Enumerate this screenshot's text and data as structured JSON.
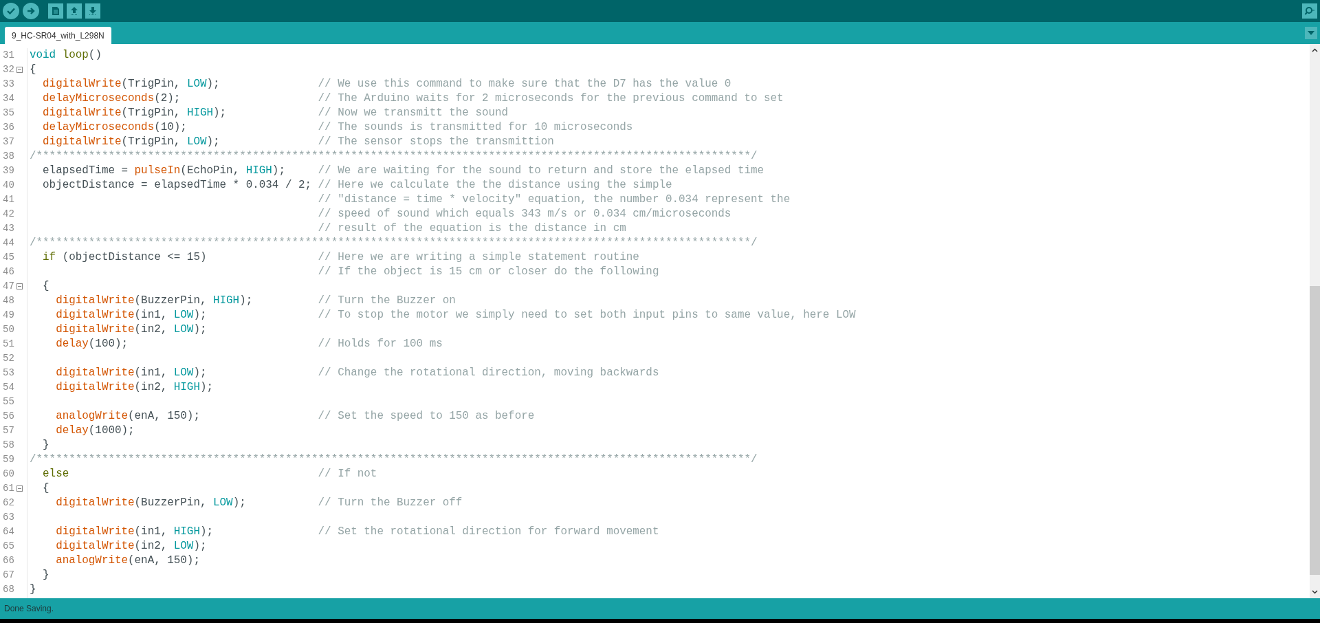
{
  "tab": {
    "label": "9_HC-SR04_with_L298N",
    "selected": true
  },
  "lines": [
    {
      "number": "31",
      "foldable": false,
      "code": [
        {
          "kind": "type",
          "text": "void"
        },
        {
          "kind": "keyword",
          "text": " loop"
        },
        {
          "kind": "plain",
          "text": "()"
        }
      ]
    },
    {
      "number": "32",
      "foldable": true,
      "code": [
        {
          "kind": "plain",
          "text": "{"
        }
      ]
    },
    {
      "number": "33",
      "foldable": false,
      "code": [
        {
          "kind": "function",
          "text": "  digitalWrite"
        },
        {
          "kind": "plain",
          "text": "(TrigPin, "
        },
        {
          "kind": "constant",
          "text": "LOW"
        },
        {
          "kind": "plain",
          "text": ");"
        }
      ],
      "comment": "// We use this command to make sure that the D7 has the value 0"
    },
    {
      "number": "34",
      "foldable": false,
      "code": [
        {
          "kind": "function",
          "text": "  delayMicroseconds"
        },
        {
          "kind": "plain",
          "text": "(2);"
        }
      ],
      "comment": "// The Arduino waits for 2 microseconds for the previous command to set"
    },
    {
      "number": "35",
      "foldable": false,
      "code": [
        {
          "kind": "function",
          "text": "  digitalWrite"
        },
        {
          "kind": "plain",
          "text": "(TrigPin, "
        },
        {
          "kind": "constant",
          "text": "HIGH"
        },
        {
          "kind": "plain",
          "text": ");"
        }
      ],
      "comment": "// Now we transmitt the sound"
    },
    {
      "number": "36",
      "foldable": false,
      "code": [
        {
          "kind": "function",
          "text": "  delayMicroseconds"
        },
        {
          "kind": "plain",
          "text": "(10);"
        }
      ],
      "comment": "// The sounds is transmitted for 10 microseconds"
    },
    {
      "number": "37",
      "foldable": false,
      "code": [
        {
          "kind": "function",
          "text": "  digitalWrite"
        },
        {
          "kind": "plain",
          "text": "(TrigPin, "
        },
        {
          "kind": "constant",
          "text": "LOW"
        },
        {
          "kind": "plain",
          "text": ");"
        }
      ],
      "comment": "// The sensor stops the transmittion"
    },
    {
      "number": "38",
      "foldable": false,
      "code": [
        {
          "kind": "comment",
          "text": "/*************************************************************************************************************/"
        }
      ]
    },
    {
      "number": "39",
      "foldable": false,
      "code": [
        {
          "kind": "plain",
          "text": "  elapsedTime = "
        },
        {
          "kind": "function",
          "text": "pulseIn"
        },
        {
          "kind": "plain",
          "text": "(EchoPin, "
        },
        {
          "kind": "constant",
          "text": "HIGH"
        },
        {
          "kind": "plain",
          "text": ");"
        }
      ],
      "comment": "// We are waiting for the sound to return and store the elapsed time"
    },
    {
      "number": "40",
      "foldable": false,
      "code": [
        {
          "kind": "plain",
          "text": "  objectDistance = elapsedTime * 0.034 / 2;"
        }
      ],
      "comment": "// Here we calculate the the distance using the simple"
    },
    {
      "number": "41",
      "foldable": false,
      "comment": "// \"distance = time * velocity\" equation, the number 0.034 represent the"
    },
    {
      "number": "42",
      "foldable": false,
      "comment": "// speed of sound which equals 343 m/s or 0.034 cm/microseconds"
    },
    {
      "number": "43",
      "foldable": false,
      "comment": "// result of the equation is the distance in cm"
    },
    {
      "number": "44",
      "foldable": false,
      "code": [
        {
          "kind": "comment",
          "text": "/*************************************************************************************************************/"
        }
      ]
    },
    {
      "number": "45",
      "foldable": false,
      "code": [
        {
          "kind": "keyword",
          "text": "  if"
        },
        {
          "kind": "plain",
          "text": " (objectDistance <= 15)"
        }
      ],
      "comment": "// Here we are writing a simple statement routine"
    },
    {
      "number": "46",
      "foldable": false,
      "comment": "// If the object is 15 cm or closer do the following"
    },
    {
      "number": "47",
      "foldable": true,
      "code": [
        {
          "kind": "plain",
          "text": "  {"
        }
      ]
    },
    {
      "number": "48",
      "foldable": false,
      "code": [
        {
          "kind": "function",
          "text": "    digitalWrite"
        },
        {
          "kind": "plain",
          "text": "(BuzzerPin, "
        },
        {
          "kind": "constant",
          "text": "HIGH"
        },
        {
          "kind": "plain",
          "text": ");"
        }
      ],
      "comment": "// Turn the Buzzer on"
    },
    {
      "number": "49",
      "foldable": false,
      "code": [
        {
          "kind": "function",
          "text": "    digitalWrite"
        },
        {
          "kind": "plain",
          "text": "(in1, "
        },
        {
          "kind": "constant",
          "text": "LOW"
        },
        {
          "kind": "plain",
          "text": ");"
        }
      ],
      "comment": "// To stop the motor we simply need to set both input pins to same value, here LOW"
    },
    {
      "number": "50",
      "foldable": false,
      "code": [
        {
          "kind": "function",
          "text": "    digitalWrite"
        },
        {
          "kind": "plain",
          "text": "(in2, "
        },
        {
          "kind": "constant",
          "text": "LOW"
        },
        {
          "kind": "plain",
          "text": ");"
        }
      ]
    },
    {
      "number": "51",
      "foldable": false,
      "code": [
        {
          "kind": "function",
          "text": "    delay"
        },
        {
          "kind": "plain",
          "text": "(100);"
        }
      ],
      "comment": "// Holds for 100 ms"
    },
    {
      "number": "52",
      "foldable": false
    },
    {
      "number": "53",
      "foldable": false,
      "code": [
        {
          "kind": "function",
          "text": "    digitalWrite"
        },
        {
          "kind": "plain",
          "text": "(in1, "
        },
        {
          "kind": "constant",
          "text": "LOW"
        },
        {
          "kind": "plain",
          "text": ");"
        }
      ],
      "comment": "// Change the rotational direction, moving backwards"
    },
    {
      "number": "54",
      "foldable": false,
      "code": [
        {
          "kind": "function",
          "text": "    digitalWrite"
        },
        {
          "kind": "plain",
          "text": "(in2, "
        },
        {
          "kind": "constant",
          "text": "HIGH"
        },
        {
          "kind": "plain",
          "text": ");"
        }
      ]
    },
    {
      "number": "55",
      "foldable": false
    },
    {
      "number": "56",
      "foldable": false,
      "code": [
        {
          "kind": "function",
          "text": "    analogWrite"
        },
        {
          "kind": "plain",
          "text": "(enA, 150);"
        }
      ],
      "comment": "// Set the speed to 150 as before"
    },
    {
      "number": "57",
      "foldable": false,
      "code": [
        {
          "kind": "function",
          "text": "    delay"
        },
        {
          "kind": "plain",
          "text": "(1000);"
        }
      ]
    },
    {
      "number": "58",
      "foldable": false,
      "code": [
        {
          "kind": "plain",
          "text": "  }"
        }
      ]
    },
    {
      "number": "59",
      "foldable": false,
      "code": [
        {
          "kind": "comment",
          "text": "/*************************************************************************************************************/"
        }
      ]
    },
    {
      "number": "60",
      "foldable": false,
      "code": [
        {
          "kind": "keyword",
          "text": "  else"
        }
      ],
      "comment": "// If not"
    },
    {
      "number": "61",
      "foldable": true,
      "code": [
        {
          "kind": "plain",
          "text": "  {"
        }
      ]
    },
    {
      "number": "62",
      "foldable": false,
      "code": [
        {
          "kind": "function",
          "text": "    digitalWrite"
        },
        {
          "kind": "plain",
          "text": "(BuzzerPin, "
        },
        {
          "kind": "constant",
          "text": "LOW"
        },
        {
          "kind": "plain",
          "text": ");"
        }
      ],
      "comment": "// Turn the Buzzer off"
    },
    {
      "number": "63",
      "foldable": false
    },
    {
      "number": "64",
      "foldable": false,
      "code": [
        {
          "kind": "function",
          "text": "    digitalWrite"
        },
        {
          "kind": "plain",
          "text": "(in1, "
        },
        {
          "kind": "constant",
          "text": "HIGH"
        },
        {
          "kind": "plain",
          "text": ");"
        }
      ],
      "comment": "// Set the rotational direction for forward movement"
    },
    {
      "number": "65",
      "foldable": false,
      "code": [
        {
          "kind": "function",
          "text": "    digitalWrite"
        },
        {
          "kind": "plain",
          "text": "(in2, "
        },
        {
          "kind": "constant",
          "text": "LOW"
        },
        {
          "kind": "plain",
          "text": ");"
        }
      ]
    },
    {
      "number": "66",
      "foldable": false,
      "code": [
        {
          "kind": "function",
          "text": "    analogWrite"
        },
        {
          "kind": "plain",
          "text": "(enA, 150);"
        }
      ]
    },
    {
      "number": "67",
      "foldable": false,
      "code": [
        {
          "kind": "plain",
          "text": "  }"
        }
      ]
    },
    {
      "number": "68",
      "foldable": false,
      "code": [
        {
          "kind": "plain",
          "text": "}"
        }
      ]
    }
  ],
  "status_bar": {
    "message": "Done Saving."
  }
}
